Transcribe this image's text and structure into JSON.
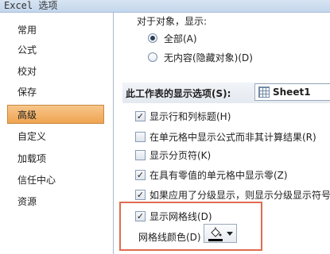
{
  "window": {
    "title": "Excel 选项"
  },
  "sidebar": {
    "items": [
      {
        "label": "常用"
      },
      {
        "label": "公式"
      },
      {
        "label": "校对"
      },
      {
        "label": "保存"
      },
      {
        "label": "高级",
        "active": true
      },
      {
        "label": "自定义"
      },
      {
        "label": "加载项"
      },
      {
        "label": "信任中心"
      },
      {
        "label": "资源"
      }
    ]
  },
  "objects": {
    "heading": "对于对象，显示:",
    "options": [
      {
        "label": "全部(A)",
        "selected": true
      },
      {
        "label": "无内容(隐藏对象)(D)",
        "selected": false
      }
    ]
  },
  "sheet_section": {
    "header": "此工作表的显示选项(S):",
    "selected_sheet": "Sheet1",
    "options": [
      {
        "label": "显示行和列标题(H)",
        "checked": true
      },
      {
        "label": "在单元格中显示公式而非其计算结果(R)",
        "checked": false
      },
      {
        "label": "显示分页符(K)",
        "checked": false
      },
      {
        "label": "在具有零值的单元格中显示零(Z)",
        "checked": true
      },
      {
        "label": "如果应用了分级显示，则显示分级显示符号",
        "checked": true
      },
      {
        "label": "显示网格线(D)",
        "checked": true
      }
    ],
    "gridline_color_label": "网格线颜色(D)"
  },
  "colors": {
    "accent_active": "#efa451",
    "highlight_box": "#e06b4e",
    "gridline_color": "#000000"
  }
}
